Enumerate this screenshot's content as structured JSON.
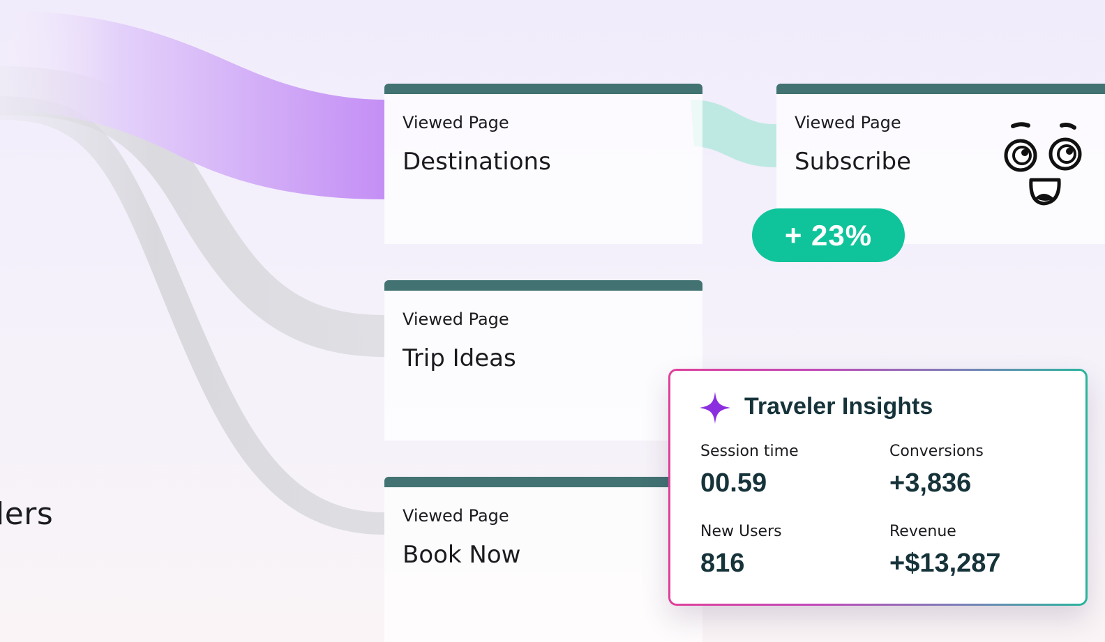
{
  "left_label": "lers",
  "pages": {
    "destinations": {
      "kicker": "Viewed Page",
      "name": "Destinations"
    },
    "trip_ideas": {
      "kicker": "Viewed Page",
      "name": "Trip Ideas"
    },
    "book_now": {
      "kicker": "Viewed Page",
      "name": "Book Now"
    },
    "subscribe": {
      "kicker": "Viewed Page",
      "name": "Subscribe"
    }
  },
  "badge": {
    "text": "+ 23%"
  },
  "insights": {
    "title": "Traveler Insights",
    "icon": "sparkle-icon",
    "metrics": [
      {
        "label": "Session time",
        "value": "00.59"
      },
      {
        "label": "Conversions",
        "value": "+3,836"
      },
      {
        "label": "New Users",
        "value": "816"
      },
      {
        "label": "Revenue",
        "value": "+$13,287"
      }
    ]
  },
  "colors": {
    "card_bar": "#427272",
    "badge": "#0fc49b",
    "purple_flow": "#c893f6",
    "teal_flow": "#b8e8e0",
    "gray_flow": "#cfcfd3",
    "title_text": "#16333a",
    "accent_purple": "#8b2ee0"
  }
}
